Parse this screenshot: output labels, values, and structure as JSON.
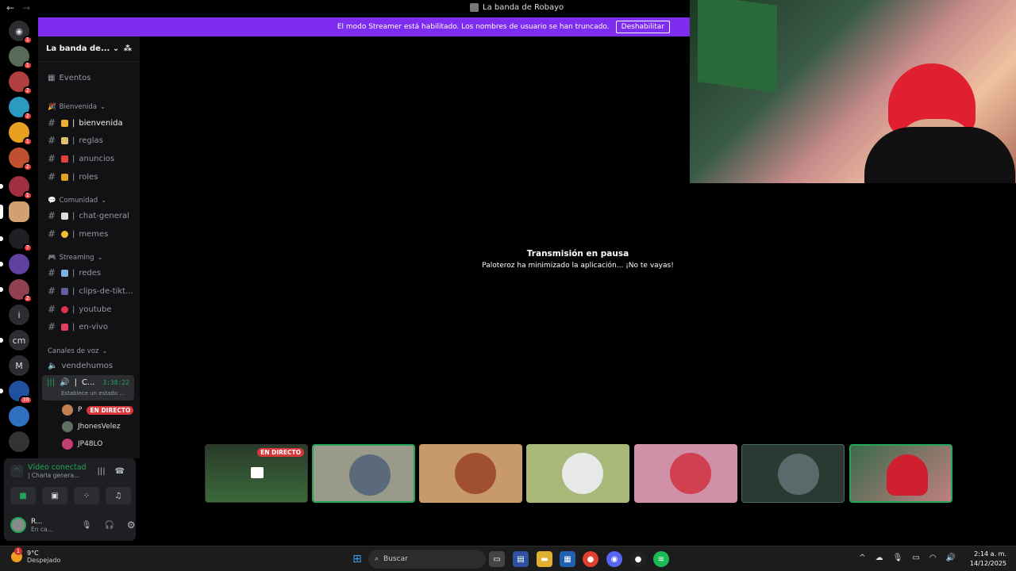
{
  "window": {
    "title": "La banda de Robayo",
    "back": "←",
    "forward": "→"
  },
  "banner": {
    "text": "El modo Streamer está habilitado. Los nombres de usuario se han truncado.",
    "button": "Deshabilitar"
  },
  "guilds": [
    {
      "label": "◉",
      "badge": "1"
    },
    {
      "label": "",
      "badge": "1"
    },
    {
      "label": "",
      "badge": "2"
    },
    {
      "label": "",
      "badge": "2"
    },
    {
      "label": "",
      "badge": "1"
    },
    {
      "label": "",
      "badge": "2"
    },
    {
      "label": "",
      "badge": "1"
    },
    {
      "label": "",
      "badge": ""
    },
    {
      "label": "",
      "badge": "7"
    },
    {
      "label": "",
      "badge": ""
    },
    {
      "label": "",
      "badge": "2"
    },
    {
      "label": "i",
      "badge": ""
    },
    {
      "label": "cm",
      "badge": ""
    },
    {
      "label": "M",
      "badge": ""
    },
    {
      "label": "",
      "badge": "38"
    },
    {
      "label": "",
      "badge": ""
    }
  ],
  "sidebar": {
    "server_name": "La banda de...",
    "events": "Eventos",
    "categories": {
      "bienvenida": "Bienvenida",
      "comunidad": "Comunidad",
      "streaming": "Streaming",
      "voz": "Canales de voz"
    },
    "channels": {
      "bienvenida": "bienvenida",
      "reglas": "reglas",
      "anuncios": "anuncios",
      "roles": "roles",
      "chat_general": "chat-general",
      "memes": "memes",
      "redes": "redes",
      "clips": "clips-de-tikt...",
      "youtube": "youtube",
      "en_vivo": "en-vivo",
      "vendehumos": "vendehumos",
      "voice_active": "C...",
      "voice_time": "3:38:22",
      "voice_status": "Establece un estado ..."
    },
    "voice_users": [
      {
        "name": "P",
        "live": "EN DIRECTO"
      },
      {
        "name": "JhonesVelez",
        "live": ""
      },
      {
        "name": "JP48LO",
        "live": ""
      }
    ]
  },
  "user_panel": {
    "voice_status": "Vídeo conectad",
    "voice_channel": "| Charla genera...",
    "username": "R...",
    "user_status": "En ca..."
  },
  "stage": {
    "pause_title": "Transmisión en pausa",
    "pause_sub": "Paloteroz ha minimizado la aplicación... ¡No te vayas!",
    "live_badge": "EN DIRECTO"
  },
  "taskbar": {
    "temp": "9°C",
    "weather": "Despejado",
    "weather_badge": "1",
    "search": "Buscar",
    "time": "2:14 a. m.",
    "date": "14/12/2025"
  }
}
